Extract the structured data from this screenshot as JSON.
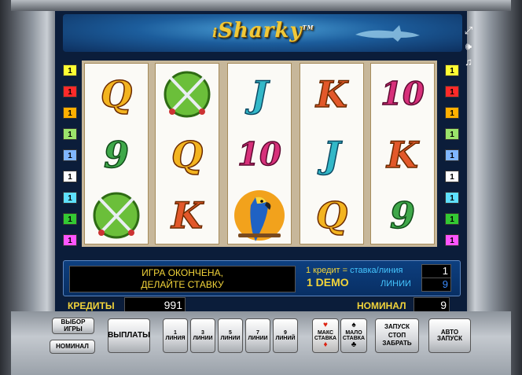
{
  "header": {
    "logo": "Sharky",
    "logo_prefix": "i",
    "trademark": "TM"
  },
  "system_icons": [
    "fullscreen-icon",
    "speaker-icon",
    "music-note-icon"
  ],
  "reels": [
    [
      "Q",
      "9",
      "crossed-swords"
    ],
    [
      "crossed-swords",
      "Q",
      "K"
    ],
    [
      "J",
      "10",
      "parrot"
    ],
    [
      "K",
      "J",
      "Q"
    ],
    [
      "10",
      "K",
      "9"
    ]
  ],
  "line_indicators": {
    "left": [
      "1",
      "1",
      "1",
      "1",
      "1",
      "1",
      "1",
      "1",
      "1"
    ],
    "right": [
      "1",
      "1",
      "1",
      "1",
      "1",
      "1",
      "1",
      "1",
      "1"
    ],
    "colors": [
      "#ffff33",
      "#ff2a2a",
      "#ffb000",
      "#9be36b",
      "#7fb6ff",
      "#ffffff",
      "#5ee0ff",
      "#33c933",
      "#ff55ff"
    ]
  },
  "info": {
    "message_line1": "ИГРА ОКОНЧЕНА,",
    "message_line2": "ДЕЛАЙТЕ СТАВКУ",
    "credit_rule": "1 кредит = ставка/линия",
    "credit_rule_a": "1 кредит =",
    "credit_rule_b": "ставка/линия",
    "demo": "1 DEMO",
    "lines_label": "ЛИНИИ",
    "bet_value": "1",
    "lines_value": "9"
  },
  "status_bar": {
    "credits_label": "КРЕДИТЫ",
    "credits_value": "991",
    "nominal_label": "НОМИНАЛ",
    "nominal_value": "9"
  },
  "buttons": {
    "select_game": [
      "ВЫБОР",
      "ИГРЫ"
    ],
    "nominal": "НОМИНАЛ",
    "payouts": "ВЫПЛАТЫ",
    "lines": [
      [
        "1",
        "ЛИНИЯ"
      ],
      [
        "3",
        "ЛИНИИ"
      ],
      [
        "5",
        "ЛИНИИ"
      ],
      [
        "7",
        "ЛИНИИ"
      ],
      [
        "9",
        "ЛИНИЙ"
      ]
    ],
    "max_bet": [
      "МАКС",
      "СТАВКА"
    ],
    "min_bet": [
      "МАЛО",
      "СТАВКА"
    ],
    "start": [
      "ЗАПУСК",
      "СТОП",
      "ЗАБРАТЬ"
    ],
    "auto_start": [
      "АВТО",
      "ЗАПУСК"
    ]
  },
  "colors": {
    "accent_yellow": "#f2d43a",
    "accent_cyan": "#45c6ff",
    "screen_blue": "#0b1d3a"
  }
}
